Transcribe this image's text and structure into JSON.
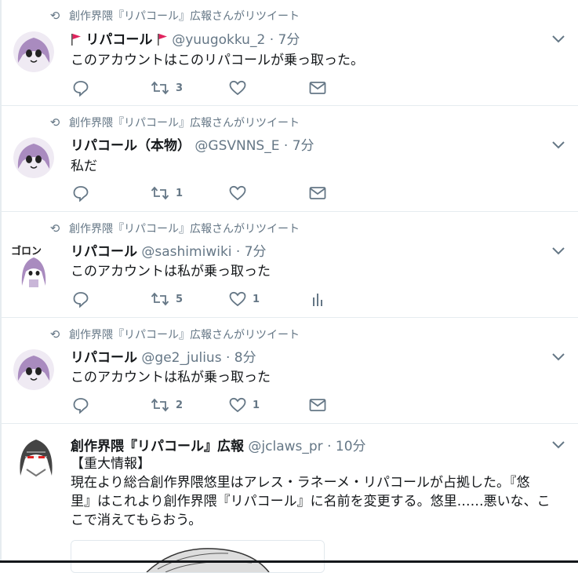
{
  "timeline": {
    "tweets": [
      {
        "retweet_context": "創作界隈『リパコール』広報さんがリツイート",
        "name": "リパコール",
        "handle": "@yuugokku_2",
        "separator": "·",
        "time": "7分",
        "text": "このアカウントはこのリパコールが乗っ取った。",
        "reply_count": "",
        "retweet_count": "3",
        "like_count": "",
        "name_flags": "red-flag-icon"
      },
      {
        "retweet_context": "創作界隈『リパコール』広報さんがリツイート",
        "name": "リパコール（本物）",
        "handle": "@GSVNNS_E",
        "separator": "·",
        "time": "7分",
        "text": "私だ",
        "reply_count": "",
        "retweet_count": "1",
        "like_count": ""
      },
      {
        "retweet_context": "創作界隈『リパコール』広報さんがリツイート",
        "name": "リパコール",
        "handle": "@sashimiwiki",
        "separator": "·",
        "time": "7分",
        "text": "このアカウントは私が乗っ取った",
        "reply_count": "",
        "retweet_count": "5",
        "like_count": "1",
        "avatar_text": "ゴロン"
      },
      {
        "retweet_context": "創作界隈『リパコール』広報さんがリツイート",
        "name": "リパコール",
        "handle": "@ge2_julius",
        "separator": "·",
        "time": "8分",
        "text": "このアカウントは私が乗っ取った",
        "reply_count": "",
        "retweet_count": "2",
        "like_count": "1"
      },
      {
        "name": "創作界隈『リパコール』広報",
        "handle": "@jclaws_pr",
        "separator": "·",
        "time": "10分",
        "text_lines": [
          "【重大情報】",
          "現在より総合創作界隈悠里はアレス・ラネーメ・リパコールが占拠した。『悠",
          "里』はこれより創作界隈『リパコール』に名前を変更する。悠里……悪いな、こ",
          "こで消えてもらおう。"
        ]
      }
    ]
  },
  "colors": {
    "text": "#14171a",
    "secondary": "#657786",
    "divider": "#e6ecf0",
    "flag": "#e0245e",
    "avatar_purple": "#a98bbf"
  }
}
